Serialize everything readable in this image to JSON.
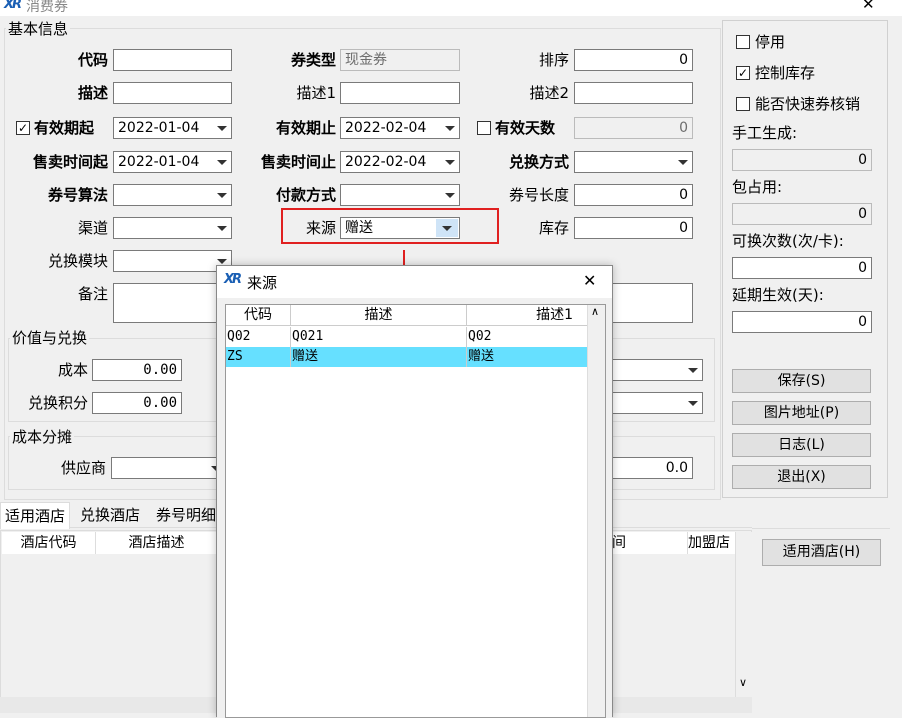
{
  "window": {
    "title": "消费券",
    "close": "✕"
  },
  "basic": {
    "group_title": "基本信息",
    "code_label": "代码",
    "code_value": "",
    "type_label": "券类型",
    "type_value": "现金券",
    "sort_label": "排序",
    "sort_value": "0",
    "desc_label": "描述",
    "desc_value": "",
    "desc1_label": "描述1",
    "desc1_value": "",
    "desc2_label": "描述2",
    "desc2_value": "",
    "valid_from_label": "有效期起",
    "valid_from_value": "2022-01-04",
    "valid_to_label": "有效期止",
    "valid_to_value": "2022-02-04",
    "valid_days_label": "有效天数",
    "valid_days_value": "0",
    "sale_from_label": "售卖时间起",
    "sale_from_value": "2022-01-04",
    "sale_to_label": "售卖时间止",
    "sale_to_value": "2022-02-04",
    "exchange_mode_label": "兑换方式",
    "exchange_mode_value": "",
    "algo_label": "券号算法",
    "algo_value": "",
    "pay_label": "付款方式",
    "pay_value": "",
    "length_label": "券号长度",
    "length_value": "0",
    "channel_label": "渠道",
    "channel_value": "",
    "source_label": "来源",
    "source_value": "赠送",
    "stock_label": "库存",
    "stock_value": "0",
    "module_label": "兑换模块",
    "module_value": "",
    "remark_label": "备注"
  },
  "value_group": {
    "title": "价值与兑换",
    "cost_label": "成本",
    "cost_value": "0.00",
    "points_label": "兑换积分",
    "points_value": "0.00"
  },
  "cost_group": {
    "title": "成本分摊",
    "supplier_label": "供应商",
    "supplier_value": "",
    "right_value": "0.0"
  },
  "right_panel": {
    "disable_label": "停用",
    "stock_control_label": "控制库存",
    "quick_verify_label": "能否快速券核销",
    "manual_label": "手工生成:",
    "manual_value": "0",
    "occupied_label": "包占用:",
    "occupied_value": "0",
    "times_label": "可换次数(次/卡):",
    "times_value": "0",
    "delay_label": "延期生效(天):",
    "delay_value": "0",
    "save": "保存(S)",
    "image": "图片地址(P)",
    "log": "日志(L)",
    "exit": "退出(X)"
  },
  "tabs": [
    "适用酒店",
    "兑换酒店",
    "券号明细"
  ],
  "hotel_grid": {
    "headers": [
      "酒店代码",
      "酒店描述",
      "间",
      "加盟店"
    ],
    "button": "适用酒店(H)"
  },
  "popup": {
    "title": "来源",
    "close": "✕",
    "headers": [
      "代码",
      "描述",
      "描述1"
    ],
    "rows": [
      {
        "code": "Q02",
        "desc": "Q021",
        "desc1": "Q02"
      },
      {
        "code": "ZS",
        "desc": "赠送",
        "desc1": "赠送"
      }
    ]
  }
}
